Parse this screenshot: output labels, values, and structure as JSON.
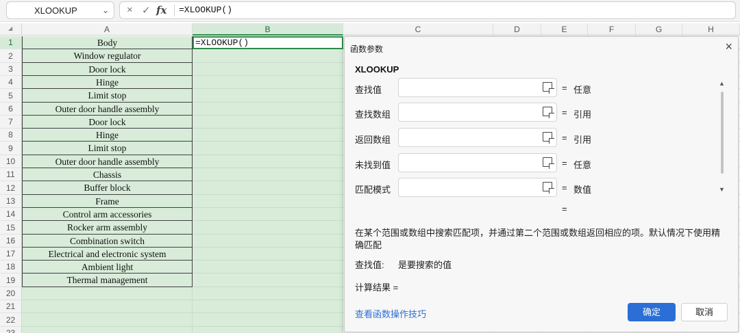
{
  "formula_bar": {
    "name_box": "XLOOKUP",
    "cancel_icon": "×",
    "confirm_icon": "✓",
    "fx_label": "fx",
    "formula": "=XLOOKUP()"
  },
  "columns": [
    "A",
    "B",
    "C",
    "D",
    "E",
    "F",
    "G",
    "H"
  ],
  "rows": [
    "1",
    "2",
    "3",
    "4",
    "5",
    "6",
    "7",
    "8",
    "9",
    "10",
    "11",
    "12",
    "13",
    "14",
    "15",
    "16",
    "17",
    "18",
    "19",
    "20",
    "21",
    "22",
    "23"
  ],
  "column_a": [
    "Body",
    "Window regulator",
    "Door lock",
    "Hinge",
    "Limit stop",
    "Outer door handle assembly",
    "Door lock",
    "Hinge",
    "Limit stop",
    "Outer door handle assembly",
    "Chassis",
    "Buffer block",
    "Frame",
    "Control arm accessories",
    "Rocker arm assembly",
    "Combination switch",
    "Electrical and electronic system",
    "Ambient light",
    "Thermal management"
  ],
  "active_cell": "=XLOOKUP()",
  "dialog": {
    "title": "函数参数",
    "close_icon": "×",
    "function_name": "XLOOKUP",
    "args": [
      {
        "label": "查找值",
        "eq": "=",
        "value": "任意"
      },
      {
        "label": "查找数组",
        "eq": "=",
        "value": "引用"
      },
      {
        "label": "返回数组",
        "eq": "=",
        "value": "引用"
      },
      {
        "label": "未找到值",
        "eq": "=",
        "value": "任意"
      },
      {
        "label": "匹配模式",
        "eq": "=",
        "value": "数值"
      }
    ],
    "result_eq": "=",
    "description": "在某个范围或数组中搜索匹配项，并通过第二个范围或数组返回相应的项。默认情况下使用精确匹配",
    "arg_help_label": "查找值:",
    "arg_help_text": "是要搜索的值",
    "calc_result_label": "计算结果 =",
    "help_link": "查看函数操作技巧",
    "ok_button": "确定",
    "cancel_button": "取消",
    "scroll_up": "▲",
    "scroll_down": "▼"
  },
  "colors": {
    "selection_fill": "#d8ecd9",
    "selection_border": "#2e8b4a",
    "primary_button": "#2b6fd6"
  }
}
